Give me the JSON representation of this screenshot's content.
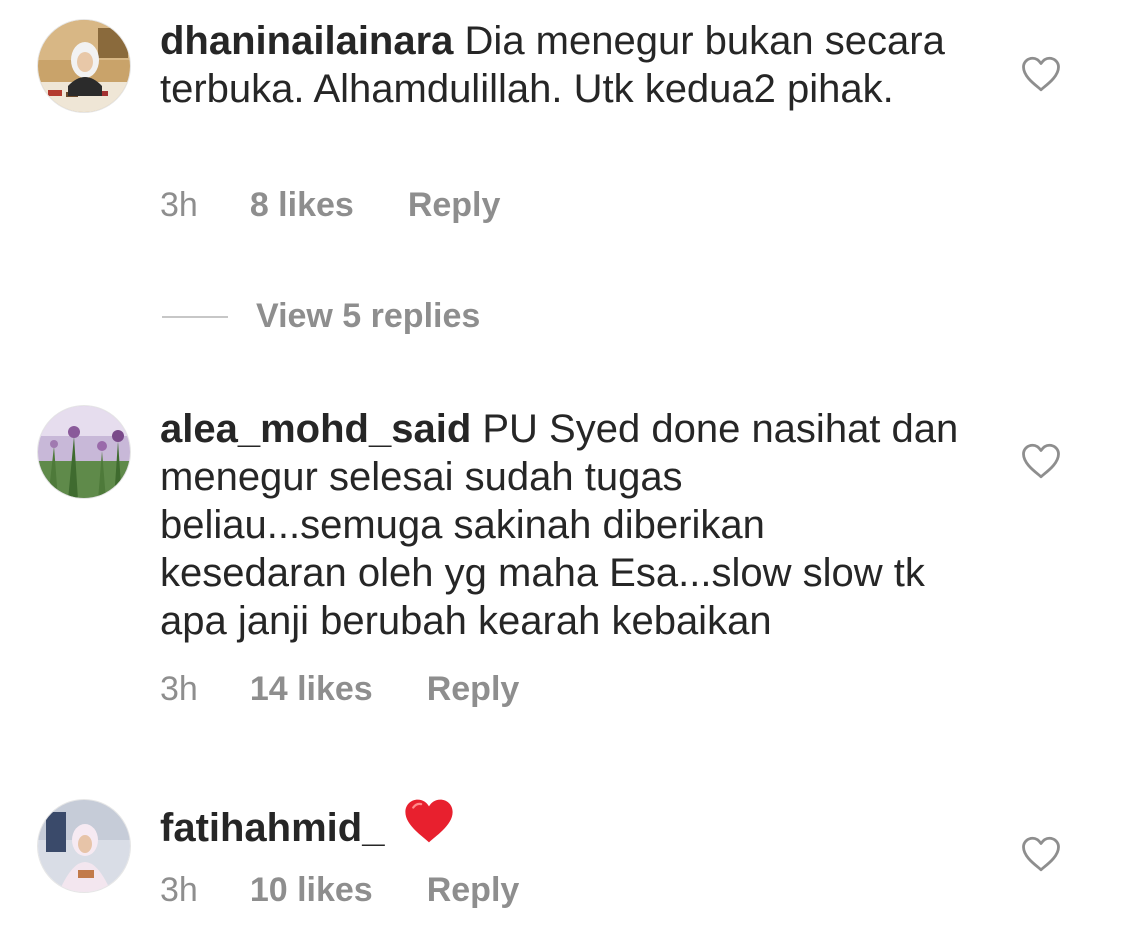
{
  "comments": [
    {
      "username": "dhaninailainara",
      "text": "Dia menegur bukan secara terbuka. Alhamdulillah. Utk kedua2 pihak.",
      "time": "3h",
      "likes": "8 likes",
      "reply_label": "Reply",
      "like_icon": "heart-outline-icon"
    },
    {
      "username": "alea_mohd_said",
      "text": "PU Syed done nasihat dan menegur selesai sudah tugas beliau...semuga sakinah diberikan kesedaran oleh yg maha Esa...slow slow tk apa janji berubah kearah kebaikan",
      "time": "3h",
      "likes": "14 likes",
      "reply_label": "Reply",
      "like_icon": "heart-outline-icon"
    },
    {
      "username": "fatihahmid_",
      "text": "",
      "emoji": "red-heart-emoji",
      "time": "3h",
      "likes": "10 likes",
      "reply_label": "Reply",
      "like_icon": "heart-outline-icon"
    }
  ],
  "view_replies": {
    "label": "View 5 replies"
  },
  "colors": {
    "text": "#262626",
    "secondary": "#8e8e8e",
    "divider": "#c7c7c7",
    "heart_red": "#e8202e"
  }
}
